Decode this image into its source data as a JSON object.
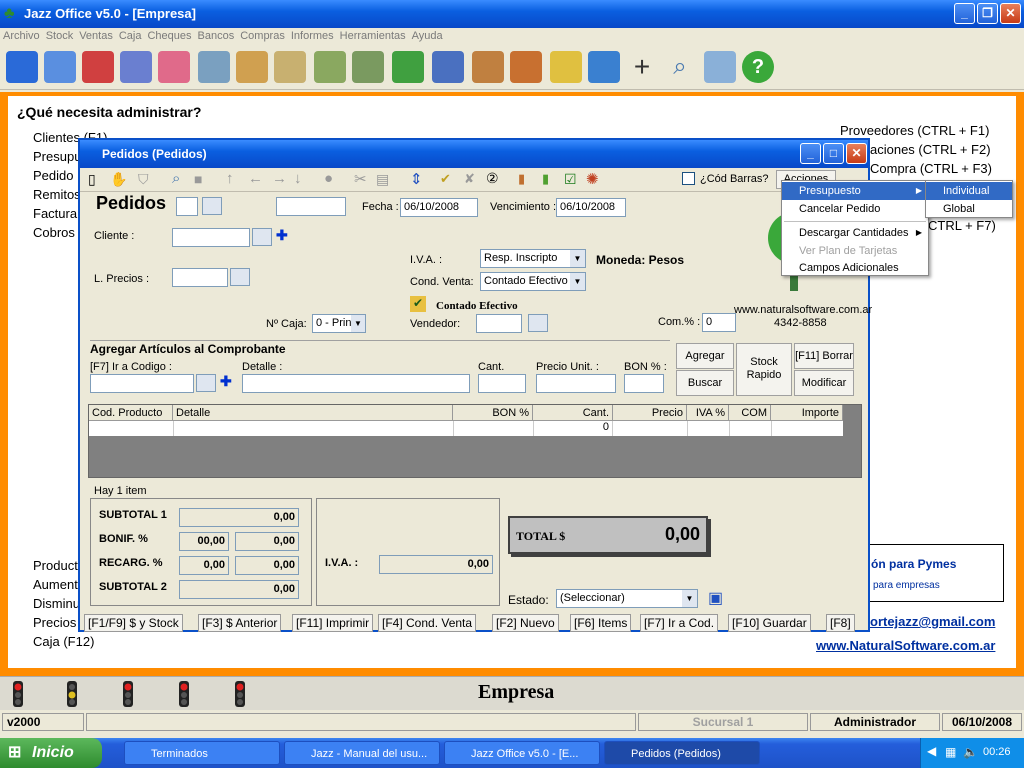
{
  "app": {
    "title": "Jazz Office v5.0 - [Empresa]"
  },
  "menu": [
    "Archivo",
    "Stock",
    "Ventas",
    "Caja",
    "Cheques",
    "Bancos",
    "Compras",
    "Informes",
    "Herramientas",
    "Ayuda"
  ],
  "main": {
    "question": "¿Qué necesita administrar?",
    "left_links": [
      "Clientes (F1)",
      "Presupu",
      "Pedido",
      "Remitos",
      "Factura",
      "Cobros"
    ],
    "left_links_bottom": [
      "Product",
      "Aument",
      "Disminu",
      "Precios",
      "Caja (F12)"
    ],
    "right_links": [
      "Proveedores (CTRL + F1)",
      "aciones (CTRL + F2)",
      "Compra (CTRL + F3)",
      "CTRL + F7)"
    ],
    "promo_title": "ón para Pymes",
    "promo_sub": "para empresas",
    "email": "ortejazz@gmail.com",
    "website": "www.NaturalSoftware.com.ar"
  },
  "pedidos": {
    "title": "Pedidos  (Pedidos)",
    "heading": "Pedidos",
    "barcode_label": "¿Cód Barras?",
    "acciones_label": "Acciones",
    "fecha_label": "Fecha :",
    "fecha": "06/10/2008",
    "venc_label": "Vencimiento :",
    "venc": "06/10/2008",
    "cliente_label": "Cliente :",
    "lprecios_label": "L. Precios :",
    "iva_label": "I.V.A. :",
    "iva_value": "Resp. Inscripto",
    "moneda": "Moneda: Pesos",
    "cond_label": "Cond. Venta:",
    "cond_value": "Contado Efectivo",
    "contado": "Contado Efectivo",
    "vendedor_label": "Vendedor:",
    "caja_label": "Nº Caja:",
    "caja_value": "0 - Prin",
    "com_label": "Com.% :",
    "com_value": "0",
    "company_site": "www.naturalsoftware.com.ar",
    "company_phone": "4342-8858",
    "agregar_title": "Agregar Artículos al Comprobante",
    "ir_codigo": "[F7] Ir a Codigo :",
    "detalle_label": "Detalle :",
    "cant_label": "Cant.",
    "precio_label": "Precio Unit. :",
    "bon_label": "BON % :",
    "btn_agregar": "Agregar",
    "btn_buscar": "Buscar",
    "btn_stock": "Stock",
    "btn_rapido": "Rapido",
    "btn_borrar": "[F11] Borrar",
    "btn_modificar": "Modificar",
    "columns": [
      "Cod. Producto",
      "Detalle",
      "BON %",
      "Cant.",
      "Precio",
      "IVA %",
      "COM %",
      "Importe"
    ],
    "row": {
      "cant": "0"
    },
    "items_count": "Hay 1 item",
    "subtotal1_label": "SUBTOTAL 1",
    "subtotal1": "0,00",
    "bonif_label": "BONIF. %",
    "bonif_pct": "00,00",
    "bonif": "0,00",
    "recarg_label": "RECARG. %",
    "recarg_pct": "0,00",
    "recarg": "0,00",
    "subtotal2_label": "SUBTOTAL 2",
    "subtotal2": "0,00",
    "iva_total_label": "I.V.A. :",
    "iva_total": "0,00",
    "total_label": "TOTAL $",
    "total": "0,00",
    "estado_label": "Estado:",
    "estado_value": "(Seleccionar)",
    "fkeys": [
      "[F1/F9] $ y Stock",
      "[F3] $ Anterior",
      "[F11] Imprimir",
      "[F4] Cond. Venta",
      "[F2] Nuevo",
      "[F6] Items",
      "[F7] Ir a Cod.",
      "[F10] Guardar",
      "[F8]"
    ]
  },
  "context_menu": {
    "items": [
      "Presupuesto",
      "Cancelar Pedido",
      "Descargar Cantidades",
      "Ver Plan de Tarjetas",
      "Campos Adicionales"
    ],
    "submenu": [
      "Individual",
      "Global"
    ]
  },
  "footer": {
    "empresa": "Empresa"
  },
  "status": {
    "version": "v2000",
    "sucursal": "Sucursal 1",
    "user": "Administrador",
    "date": "06/10/2008"
  },
  "taskbar": {
    "start": "Inicio",
    "tasks": [
      "Terminados",
      "Jazz - Manual del usu...",
      "Jazz Office v5.0 - [E...",
      "Pedidos  (Pedidos)"
    ],
    "clock": "00:26"
  },
  "colors": {
    "titlebar": "#0a5fe0",
    "orange": "#ff8c00",
    "accent": "#316ac5"
  }
}
